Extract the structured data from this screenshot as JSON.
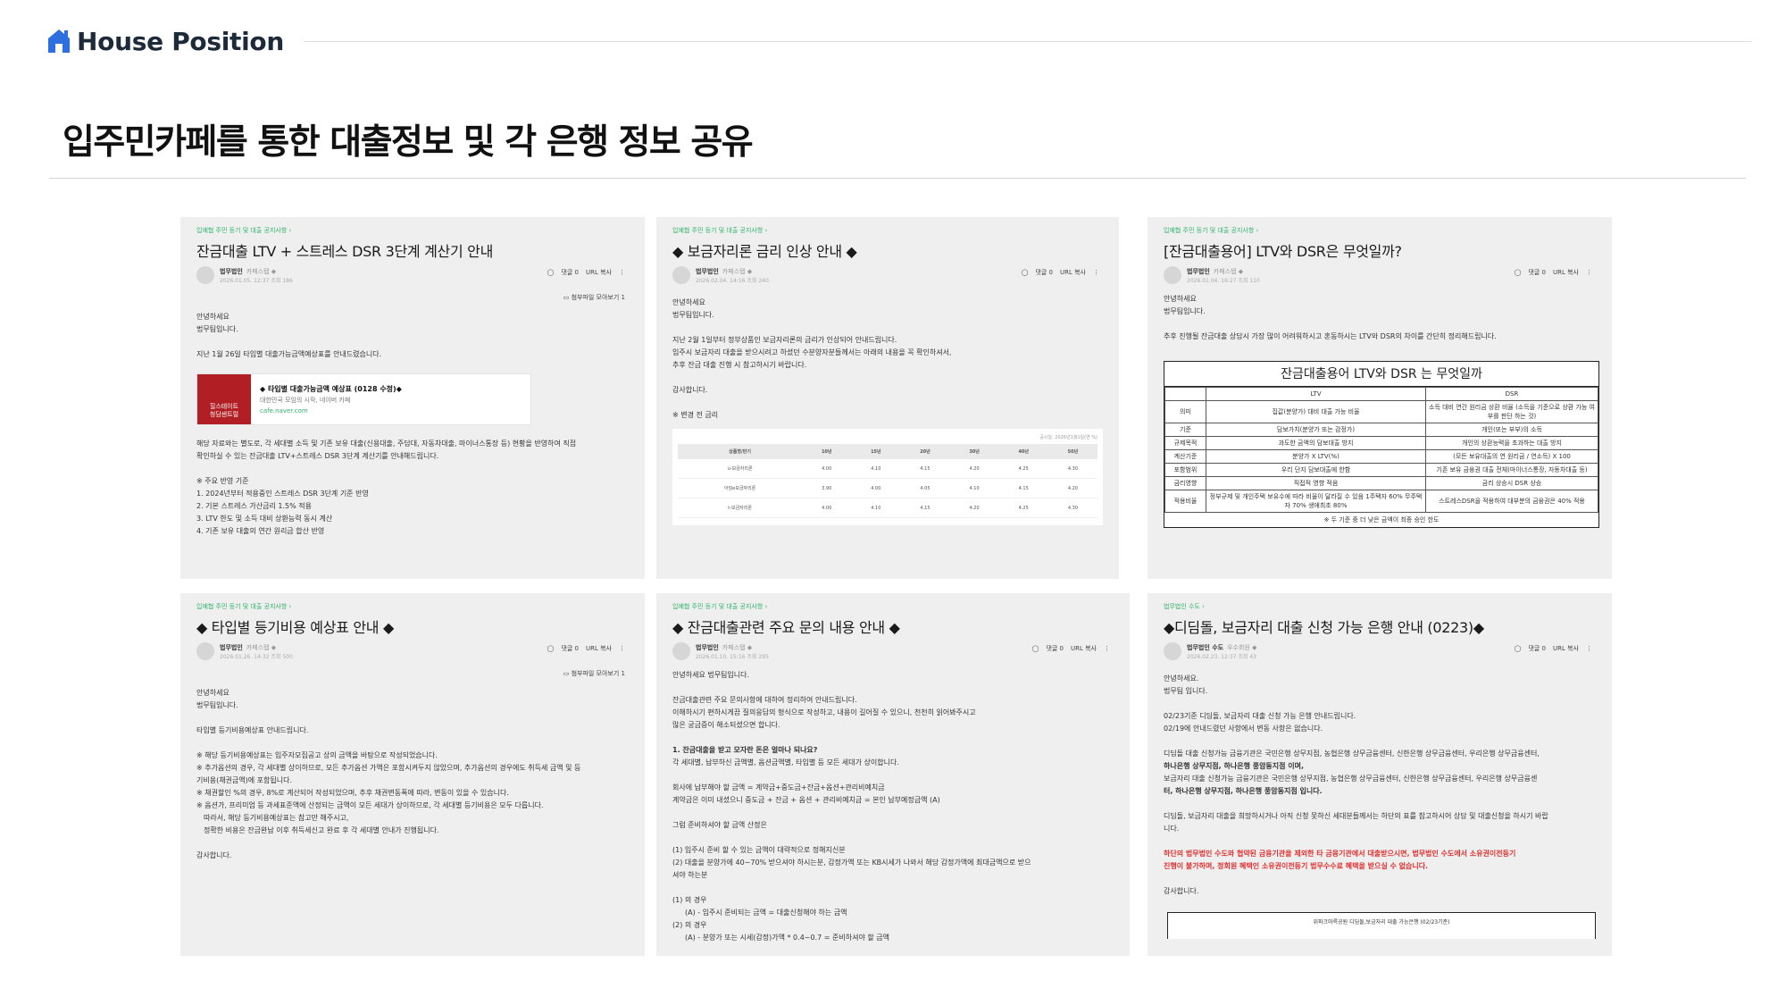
{
  "header": {
    "logo_text": "House Position"
  },
  "page": {
    "title": "입주민카페를 통한 대출정보 및 각 은행 정보 공유"
  },
  "cards": {
    "c1": {
      "crumb": "입예협 주민 등기 및 대출 공지사항 ›",
      "title": "잔금대출 LTV + 스트레스 DSR 3단계 계산기 안내",
      "author": "법무법인",
      "author_sub": "카페스탭 ◆",
      "date": "2026.01.05. 12:37  조회 186",
      "comments": "댓글 0",
      "url_copy": "URL 복사",
      "attach": "첨부파일 모아보기 1",
      "p1": "안녕하세요",
      "p2": "법무팀입니다.",
      "p3": "지난 1월 26일 타입별 대출가능금액예상표를 안내드렸습니다.",
      "link": {
        "thumb1": "힐스테이트",
        "thumb2": "청담센트럴",
        "title": "◆ 타입별 대출가능금액 예상표 (0128 수정)◆",
        "desc": "대한민국 모임의 시작, 네이버 카페",
        "url": "cafe.naver.com"
      },
      "p4": "해당 자료와는 별도로, 각 세대별 소득 및 기존 보유 대출(신용대출, 주담대, 자동차대출, 마이너스통장 등) 현황을 반영하여 직접",
      "p5": "확인하실 수 있는 잔금대출 LTV+스트레스 DSR 3단계 계산기를 안내해드립니다.",
      "p6": "※ 주요 반영 기준",
      "p7": "1. 2024년부터 적용중인 스트레스 DSR 3단계 기준 반영",
      "p8": "2. 기본 스트레스 가산금리 1.5% 적용",
      "p9": "3. LTV 한도 및 소득 대비 상환능력 동시 계산",
      "p10": "4. 기존 보유 대출의 연간 원리금 합산 반영"
    },
    "c2": {
      "crumb": "입예협 주민 등기 및 대출 공지사항 ›",
      "title": "◆ 보금자리론 금리 인상 안내 ◆",
      "author": "법무법인",
      "author_sub": "카페스탭 ◆",
      "date": "2026.02.04. 14:16  조회 240",
      "comments": "댓글 0",
      "url_copy": "URL 복사",
      "p1": "안녕하세요",
      "p2": "법무팀입니다.",
      "p3": "지난 2월 1일부터 정부상품인 보금자리론의 금리가 인상되어 안내드립니다.",
      "p4": "입주시 보금자리 대출을 받으시려고 하셨던 수분양자분들께서는 아래의 내용을 꼭 확인하셔서,",
      "p5": "추후 잔금 대출 진행 시 참고하시기 바랍니다.",
      "p6": "감사합니다.",
      "p7": "※ 변경 전 금리",
      "table_note": "공시일: 2026년1월1일(연 %)",
      "headers": [
        "상품명/만기",
        "10년",
        "15년",
        "20년",
        "30년",
        "40년",
        "50년"
      ],
      "rows": [
        [
          "u-보금자리론",
          "4.00",
          "4.10",
          "4.15",
          "4.20",
          "4.25",
          "4.30"
        ],
        [
          "아낌e보금자리론",
          "3.90",
          "4.00",
          "4.05",
          "4.10",
          "4.15",
          "4.20"
        ],
        [
          "t-보금자리론",
          "4.00",
          "4.10",
          "4.15",
          "4.20",
          "4.25",
          "4.30"
        ]
      ]
    },
    "c3": {
      "crumb": "입예협 주민 등기 및 대출 공지사항 ›",
      "title": "[잔금대출용어] LTV와 DSR은 무엇일까?",
      "author": "법무법인",
      "author_sub": "카페스탭 ◆",
      "date": "2026.01.04. 16:27  조회 110",
      "comments": "댓글 0",
      "url_copy": "URL 복사",
      "p1": "안녕하세요",
      "p2": "법무팀입니다.",
      "p3": "추후 진행될 잔금대출 상담시 가장 많이 어려워하시고 혼동하시는 LTV와 DSR의 차이를 간단히 정리해드립니다.",
      "table_title": "잔금대출용어 LTV와 DSR 는 무엇일까",
      "col_ltv": "LTV",
      "col_dsr": "DSR",
      "rows": [
        [
          "의미",
          "집값(분양가) 대비 대출 가능 비율",
          "소득 대비 연간 원리금 상환 비율 (소득을 기준으로 상환 가능 여부를 판단 하는 것)"
        ],
        [
          "기준",
          "담보가치(분양가 또는 감정가)",
          "개인(또는 부부)의 소득"
        ],
        [
          "규제목적",
          "과도한 금액의 담보대출 방지",
          "개인의 상환능력을 초과하는 대출 방지"
        ],
        [
          "계산기준",
          "분양가 X LTV(%)",
          "(모든 보유대출의 연 원리금 / 연소득) X 100"
        ],
        [
          "포함범위",
          "우리 단지 담보대출에 한함",
          "기존 보유 금융권 대출 전체(마이너스통장, 자동차대출 등)"
        ],
        [
          "금리영향",
          "직접적 영향 적음",
          "금리 상승시 DSR 상승"
        ],
        [
          "적용비율",
          "정부규제 및 개인주택 보유수에 따라 비율이 달라질 수 있음 1주택자 60% 무주택자 70% 생애최초 80%",
          "스트레스DSR을 적용하여 대부분의 금융권은 40% 적용"
        ]
      ],
      "foot": "※ 두 기준 중 더 낮은 금액이 최종 승인 한도"
    },
    "c4": {
      "crumb": "입예협 주민 등기 및 대출 공지사항 ›",
      "title": "◆ 타입별 등기비용 예상표 안내 ◆",
      "author": "법무법인",
      "author_sub": "카페스탭 ◆",
      "date": "2026.01.26. 14:32  조회 500",
      "comments": "댓글 0",
      "url_copy": "URL 복사",
      "attach": "첨부파일 모아보기 1",
      "p1": "안녕하세요",
      "p2": "법무팀입니다.",
      "p3": "타입별 등기비용예상표 안내드립니다.",
      "p4": "※ 해당 등기비용예상표는 입주자모집공고 상의 금액을 바탕으로 작성되었습니다.",
      "p5": "※ 추가옵션의 경우, 각 세대별 상이하므로, 모든 추가옵션 가액은 포함시켜두지 않았으며, 추가옵션의 경우에도 취득세 금액 및 등",
      "p6": "기비용(채권금액)에 포함됩니다.",
      "p7": "※ 채권할인 %의 경우, 8%로 계산되어 작성되었으며, 추후 채권변동폭에 따라, 변동이 있을 수 있습니다.",
      "p8": "※ 옵션가, 프리미엄 등 과세표준액에 산정되는 금액이 모든 세대가 상이하므로, 각 세대별 등기비용은 모두 다릅니다.",
      "p9": "따라서, 해당 등기비용예상표는 참고만 해주시고,",
      "p10": "정확한 비용은 잔금완납 이후 취득세신고 완료 후 각 세대별 안내가 진행됩니다.",
      "p11": "감사합니다."
    },
    "c5": {
      "crumb": "입예협 주민 등기 및 대출 공지사항 ›",
      "title": "◆ 잔금대출관련 주요 문의 내용 안내 ◆",
      "author": "법무법인",
      "author_sub": "카페스탭 ◆",
      "date": "2026.01.10. 15:16  조회 295",
      "comments": "댓글 0",
      "url_copy": "URL 복사",
      "p1": "안녕하세요 법무팀입니다.",
      "p2": "잔금대출관련 주요 문의사항에 대하여 정리하여 안내드립니다.",
      "p3": "이해하시기 편하시게끔 질의응답의 형식으로 작성하고, 내용이 길어질 수 있으니, 천천히 읽어봐주시고",
      "p4": "많은 궁금증이 해소되셨으면 합니다.",
      "p5": "1. 잔금대출을 받고 모자란 돈은 얼마나 되나요?",
      "p6": "각 세대별, 납부하신 금액별, 옵션금액별, 타입별 등 모든 세대가 상이합니다.",
      "p7": "회사에 납부해야 할 금액 = 계약금+중도금+잔금+옵션+관리비예치금",
      "p8": "계약금은 이미 내셨으니 중도금 + 잔금 + 옵션 + 관리비예치금 = 본인 납부예정금액 (A)",
      "p9": "그럼 준비하셔야 할 금액 산정은",
      "p10": "(1) 입주시 준비 할 수 있는 금액이 대략적으로 정해지신분",
      "p11": "(2) 대출을 분양가에 40~70% 받으셔야 하시는분, 감정가액 또는 KB시세가 나와서 해당 감정가액에 최대금액으로 받으",
      "p12": "셔야 하는분",
      "p13": "(1) 의 경우",
      "p14": "(A) - 입주시 준비되는 금액 = 대출신청해야 하는 금액",
      "p15": "(2) 의 경우",
      "p16": "(A) - 분양가 또는 시세(감정)가액 * 0.4~0.7 = 준비하셔야 할 금액"
    },
    "c6": {
      "crumb": "법무법인 수도 ›",
      "title": "◆디딤돌, 보금자리 대출 신청 가능 은행 안내 (0223)◆",
      "author": "법무법인 수도",
      "author_sub": "우수회원 ◆",
      "date": "2026.02.23. 12:37  조회 43",
      "comments": "댓글 0",
      "url_copy": "URL 복사",
      "p1": "안녕하세요.",
      "p2": "법무팀 입니다.",
      "p3": "02/23기준 디딤돌, 보금자리 대출 신청 가능 은행 안내드립니다.",
      "p4": "02/19에 안내드렸던 사항에서 변동 사항은 없습니다.",
      "p5": "디딤돌 대출 신청가능 금융기관은 국민은행 상무지점, 농협은행 상무금융센터, 신한은행 상무금융센터, 우리은행 상무금융센터,",
      "p6": "하나은행 상무지점, 하나은행 풍암동지점 이며,",
      "p7": "보금자리 대출 신청가능 금융기관은 국민은행 상무지점, 농협은행 상무금융센터, 신한은행 상무금융센터, 우리은행 상무금융센",
      "p8": "터, 하나은행 상무지점, 하나은행 풍암동지점 입니다.",
      "p9": "디딤돌, 보금자리 대출을 희망하시거나 아직 신청 못하신 세대분들께서는 하단의 표를 참고하시어 상담 및 대출신청을 하시기 바랍",
      "p10": "니다.",
      "p11": "하단의 법무법인 수도와 협약된 금융기관을 제외한 타 금융기관에서 대출받으시면, 법무법인 수도에서 소유권이전등기",
      "p12": "진행이 불가하며, 정회원 혜택인 소유권이전등기 법무수수료 혜택을 받으실 수 없습니다.",
      "p13": "감사합니다.",
      "box_title": "위파크마륵공원 디딤돌,보금자리 대출 가능은행 (02/23기준)"
    }
  },
  "colors": {
    "brand": "#2d6fe0",
    "card_bg": "#efefef",
    "crumb_green": "#2fb36b"
  }
}
